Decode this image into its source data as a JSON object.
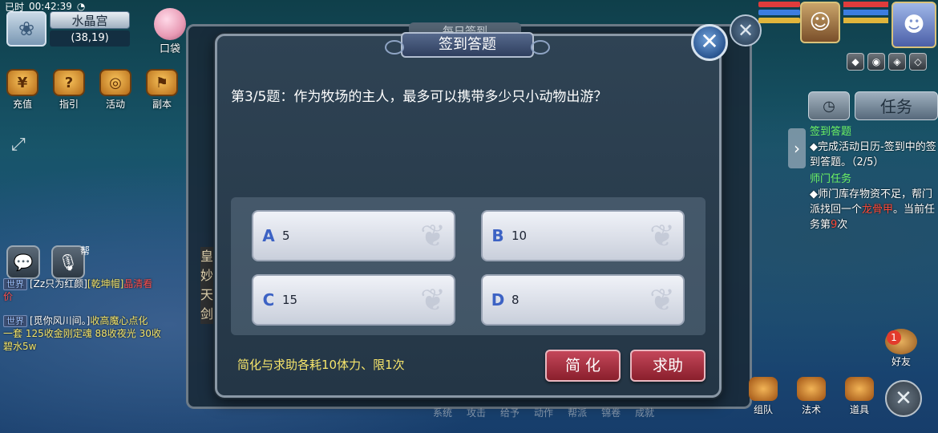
{
  "status": {
    "signal": "已时",
    "time": "00:42:39"
  },
  "location": {
    "map_name": "水晶宫",
    "coords": "(38,19)"
  },
  "pet_button": {
    "label": "口袋"
  },
  "quick_actions": [
    {
      "label": "充值",
      "icon": "recharge-icon"
    },
    {
      "label": "指引",
      "icon": "guide-icon"
    },
    {
      "label": "活动",
      "icon": "activity-icon"
    },
    {
      "label": "副本",
      "icon": "dungeon-icon"
    }
  ],
  "help_label": "帮",
  "chat": [
    {
      "tag": "世界",
      "parts": [
        "[Zz只为红颜]",
        "[乾坤帽]",
        "晶清看"
      ],
      "extra": "价"
    },
    {
      "tag": "世界",
      "parts": [
        "[觅你风川间。]",
        "收高魔心点化"
      ],
      "line2": "一套 125收金刚定魂 88收夜光 30收",
      "line3": "碧水5w"
    }
  ],
  "background_dialog": {
    "title": "每日签到",
    "side_text": [
      "皇",
      "妙",
      "天",
      "剑"
    ]
  },
  "dialog": {
    "title": "签到答题",
    "question": "第3/5题：作为牧场的主人，最多可以携带多少只小动物出游？",
    "options": [
      {
        "letter": "A",
        "value": "5"
      },
      {
        "letter": "B",
        "value": "10"
      },
      {
        "letter": "C",
        "value": "15"
      },
      {
        "letter": "D",
        "value": "8"
      }
    ],
    "note": "简化与求助各耗10体力、限1次",
    "simplify_label": "简 化",
    "help_label": "求助",
    "close_symbol": "✕"
  },
  "right_panel": {
    "task_tab": "任务",
    "tasks": [
      {
        "title": "签到答题",
        "desc": "◆完成活动日历-签到中的签到答题。（2/5）"
      },
      {
        "title": "师门任务",
        "desc_a": "◆师门库存物资不足，帮门派找回一个",
        "desc_red": "龙骨甲",
        "desc_b": "。当前任务第",
        "desc_num": "9",
        "desc_c": "次"
      }
    ]
  },
  "friend": {
    "badge": "1",
    "label": "好友"
  },
  "bottom_menu": [
    "系统",
    "攻击",
    "给予",
    "动作",
    "帮派",
    "锦卷",
    "成就"
  ],
  "bottom_icons": [
    {
      "label": "组队"
    },
    {
      "label": "法术"
    },
    {
      "label": "道具"
    }
  ],
  "colors": {
    "accent_red": "#c4475a",
    "note_yellow": "#f6e56b",
    "task_green": "#6cf262",
    "option_letter": "#3c62c4"
  }
}
